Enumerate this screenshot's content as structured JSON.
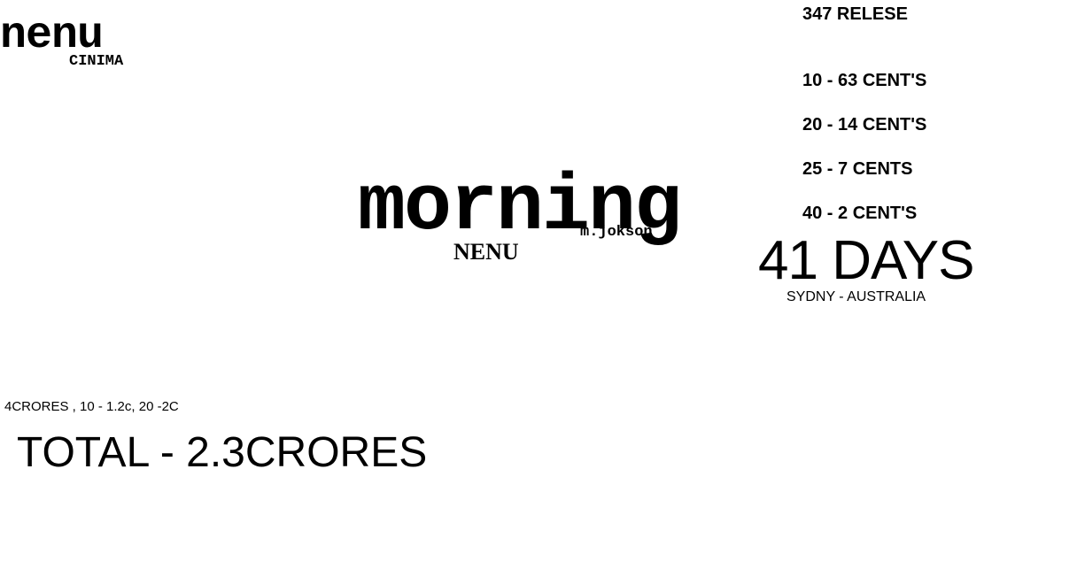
{
  "logo": {
    "name": "nenu",
    "subtitle": "CINIMA"
  },
  "title": {
    "main": "morning",
    "credit": "m.jokson",
    "sub": "NENU"
  },
  "stats": {
    "release": "347 RELESE",
    "rates": [
      "10 - 63 CENT'S",
      "20 - 14 CENT'S",
      "25 - 7 CENTS",
      "40 - 2 CENT'S"
    ],
    "days": "41 DAYS",
    "location": "SYDNY - AUSTRALIA"
  },
  "totals": {
    "breakdown": "4CRORES ,  10 - 1.2c, 20 -2C",
    "total": "TOTAL - 2.3CRORES"
  }
}
